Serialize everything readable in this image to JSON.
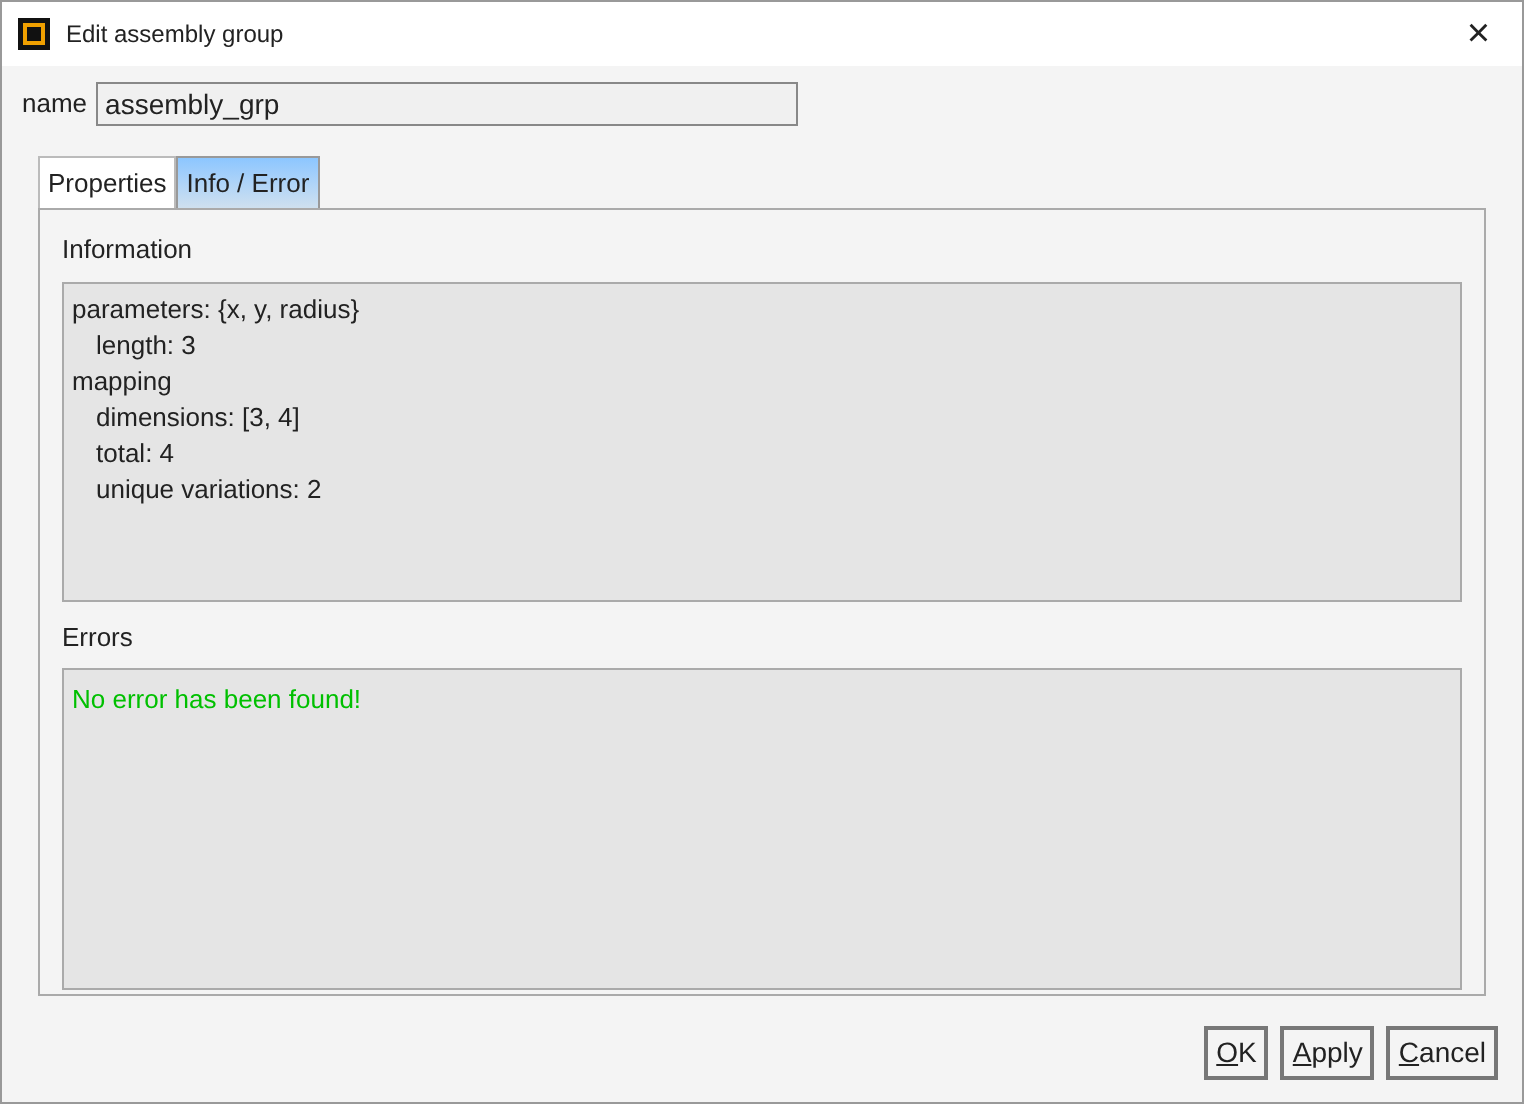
{
  "window": {
    "title": "Edit assembly group",
    "close": "×"
  },
  "name_field": {
    "label": "name",
    "value": "assembly_grp"
  },
  "tabs": [
    {
      "label": "Properties",
      "selected": false
    },
    {
      "label": "Info / Error",
      "selected": true
    }
  ],
  "information": {
    "heading": "Information",
    "lines": [
      {
        "text": "parameters: {x, y, radius}",
        "children": [
          {
            "text": "length: 3"
          }
        ]
      },
      {
        "text": "mapping",
        "children": [
          {
            "text": "dimensions: [3, 4]"
          },
          {
            "text": "total: 4"
          },
          {
            "text": "unique variations: 2"
          }
        ]
      }
    ]
  },
  "errors": {
    "heading": "Errors",
    "message": "No error has been found!",
    "color": "#00c000"
  },
  "buttons": [
    {
      "label": "OK",
      "underline_first": true
    },
    {
      "label": "Apply",
      "underline_first": true
    },
    {
      "label": "Cancel",
      "underline_first": true
    }
  ]
}
